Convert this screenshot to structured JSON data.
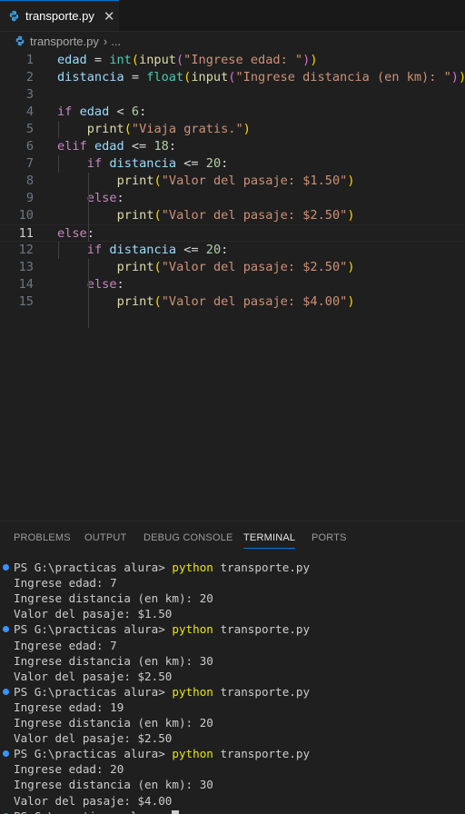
{
  "tab": {
    "filename": "transporte.py",
    "close_glyph": "✕"
  },
  "breadcrumb": {
    "file": "transporte.py",
    "separator": "›",
    "more": "..."
  },
  "editor": {
    "current_line": 11,
    "lines": [
      {
        "n": "1",
        "indent": 0,
        "tokens": [
          [
            "var",
            "edad"
          ],
          [
            "op",
            " = "
          ],
          [
            "cls",
            "int"
          ],
          [
            "p1",
            "("
          ],
          [
            "fn",
            "input"
          ],
          [
            "p2",
            "("
          ],
          [
            "str",
            "\"Ingrese edad: \""
          ],
          [
            "p2",
            ")"
          ],
          [
            "p1",
            ")"
          ]
        ]
      },
      {
        "n": "2",
        "indent": 0,
        "tokens": [
          [
            "var",
            "distancia"
          ],
          [
            "op",
            " = "
          ],
          [
            "cls",
            "float"
          ],
          [
            "p1",
            "("
          ],
          [
            "fn",
            "input"
          ],
          [
            "p2",
            "("
          ],
          [
            "str",
            "\"Ingrese distancia (en km): \""
          ],
          [
            "p2",
            ")"
          ],
          [
            "p1",
            ")"
          ]
        ]
      },
      {
        "n": "3",
        "indent": 0,
        "tokens": []
      },
      {
        "n": "4",
        "indent": 0,
        "tokens": [
          [
            "ctl",
            "if"
          ],
          [
            "op",
            " "
          ],
          [
            "var",
            "edad"
          ],
          [
            "op",
            " < "
          ],
          [
            "num",
            "6"
          ],
          [
            "op",
            ":"
          ]
        ]
      },
      {
        "n": "5",
        "indent": 1,
        "tokens": [
          [
            "fn",
            "print"
          ],
          [
            "p1",
            "("
          ],
          [
            "str",
            "\"Viaja gratis.\""
          ],
          [
            "p1",
            ")"
          ]
        ]
      },
      {
        "n": "6",
        "indent": 0,
        "tokens": [
          [
            "ctl",
            "elif"
          ],
          [
            "op",
            " "
          ],
          [
            "var",
            "edad"
          ],
          [
            "op",
            " <= "
          ],
          [
            "num",
            "18"
          ],
          [
            "op",
            ":"
          ]
        ]
      },
      {
        "n": "7",
        "indent": 1,
        "tokens": [
          [
            "ctl",
            "if"
          ],
          [
            "op",
            " "
          ],
          [
            "var",
            "distancia"
          ],
          [
            "op",
            " <= "
          ],
          [
            "num",
            "20"
          ],
          [
            "op",
            ":"
          ]
        ]
      },
      {
        "n": "8",
        "indent": 2,
        "tokens": [
          [
            "fn",
            "print"
          ],
          [
            "p1",
            "("
          ],
          [
            "str",
            "\"Valor del pasaje: $1.50\""
          ],
          [
            "p1",
            ")"
          ]
        ]
      },
      {
        "n": "9",
        "indent": 1,
        "tokens": [
          [
            "ctl",
            "else"
          ],
          [
            "op",
            ":"
          ]
        ]
      },
      {
        "n": "10",
        "indent": 2,
        "tokens": [
          [
            "fn",
            "print"
          ],
          [
            "p1",
            "("
          ],
          [
            "str",
            "\"Valor del pasaje: $2.50\""
          ],
          [
            "p1",
            ")"
          ]
        ]
      },
      {
        "n": "11",
        "indent": 0,
        "tokens": [
          [
            "ctl",
            "else"
          ],
          [
            "op",
            ":"
          ]
        ]
      },
      {
        "n": "12",
        "indent": 1,
        "tokens": [
          [
            "ctl",
            "if"
          ],
          [
            "op",
            " "
          ],
          [
            "var",
            "distancia"
          ],
          [
            "op",
            " <= "
          ],
          [
            "num",
            "20"
          ],
          [
            "op",
            ":"
          ]
        ]
      },
      {
        "n": "13",
        "indent": 2,
        "tokens": [
          [
            "fn",
            "print"
          ],
          [
            "p1",
            "("
          ],
          [
            "str",
            "\"Valor del pasaje: $2.50\""
          ],
          [
            "p1",
            ")"
          ]
        ]
      },
      {
        "n": "14",
        "indent": 1,
        "tokens": [
          [
            "ctl",
            "else"
          ],
          [
            "op",
            ":"
          ]
        ]
      },
      {
        "n": "15",
        "indent": 2,
        "tokens": [
          [
            "fn",
            "print"
          ],
          [
            "p1",
            "("
          ],
          [
            "str",
            "\"Valor del pasaje: $4.00\""
          ],
          [
            "p1",
            ")"
          ]
        ]
      }
    ]
  },
  "panel": {
    "tabs": [
      {
        "label": "PROBLEMS",
        "active": false
      },
      {
        "label": "OUTPUT",
        "active": false
      },
      {
        "label": "DEBUG CONSOLE",
        "active": false
      },
      {
        "label": "TERMINAL",
        "active": true
      },
      {
        "label": "PORTS",
        "active": false
      }
    ]
  },
  "terminal": {
    "lines": [
      {
        "prompt": "PS G:\\practicas alura> ",
        "cmd": "python",
        "args": " transporte.py"
      },
      {
        "text": "Ingrese edad: 7"
      },
      {
        "text": "Ingrese distancia (en km): 20"
      },
      {
        "text": "Valor del pasaje: $1.50"
      },
      {
        "prompt": "PS G:\\practicas alura> ",
        "cmd": "python",
        "args": " transporte.py"
      },
      {
        "text": "Ingrese edad: 7"
      },
      {
        "text": "Ingrese distancia (en km): 30"
      },
      {
        "text": "Valor del pasaje: $2.50"
      },
      {
        "prompt": "PS G:\\practicas alura> ",
        "cmd": "python",
        "args": " transporte.py"
      },
      {
        "text": "Ingrese edad: 19"
      },
      {
        "text": "Ingrese distancia (en km): 20"
      },
      {
        "text": "Valor del pasaje: $2.50"
      },
      {
        "prompt": "PS G:\\practicas alura> ",
        "cmd": "python",
        "args": " transporte.py"
      },
      {
        "text": "Ingrese edad: 20"
      },
      {
        "text": "Ingrese distancia (en km): 30"
      },
      {
        "text": "Valor del pasaje: $4.00"
      },
      {
        "prompt": "PS G:\\practicas alura> ",
        "cursor": true
      }
    ]
  }
}
